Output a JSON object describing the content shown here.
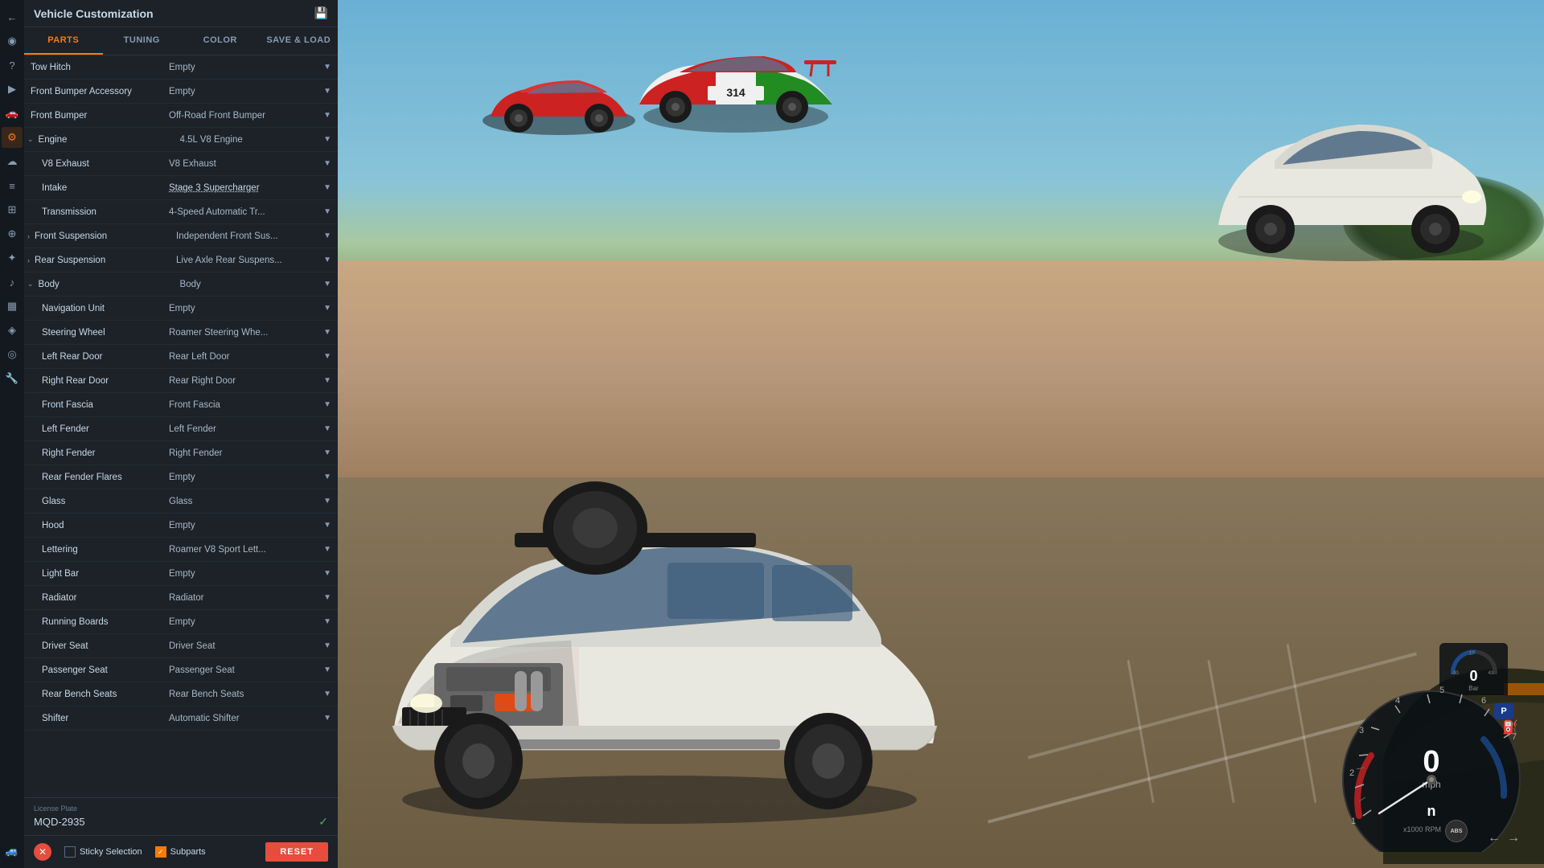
{
  "panel": {
    "title": "Vehicle Customization",
    "tabs": [
      {
        "id": "parts",
        "label": "PARTS",
        "active": true
      },
      {
        "id": "tuning",
        "label": "TUNING",
        "active": false
      },
      {
        "id": "color",
        "label": "COLOR",
        "active": false
      },
      {
        "id": "save_load",
        "label": "SAVE & LOAD",
        "active": false
      }
    ]
  },
  "parts": [
    {
      "name": "Tow Hitch",
      "value": "Empty",
      "indent": 0,
      "dropdown": true,
      "underline": false
    },
    {
      "name": "Front Bumper Accessory",
      "value": "Empty",
      "indent": 0,
      "dropdown": true,
      "underline": false
    },
    {
      "name": "Front Bumper",
      "value": "Off-Road Front Bumper",
      "indent": 0,
      "dropdown": true,
      "underline": false
    },
    {
      "name": "Engine",
      "value": "4.5L V8 Engine",
      "indent": 0,
      "dropdown": true,
      "underline": false,
      "expandable": true,
      "expanded": true
    },
    {
      "name": "V8 Exhaust",
      "value": "V8 Exhaust",
      "indent": 1,
      "dropdown": true,
      "underline": false
    },
    {
      "name": "Intake",
      "value": "Stage 3 Supercharger",
      "indent": 1,
      "dropdown": true,
      "underline": true
    },
    {
      "name": "Transmission",
      "value": "4-Speed Automatic Tr...",
      "indent": 1,
      "dropdown": true,
      "underline": false
    },
    {
      "name": "Front Suspension",
      "value": "Independent Front Sus...",
      "indent": 0,
      "dropdown": true,
      "underline": false,
      "expandable": true,
      "expanded": false,
      "expandDir": "right"
    },
    {
      "name": "Rear Suspension",
      "value": "Live Axle Rear Suspens...",
      "indent": 0,
      "dropdown": true,
      "underline": false,
      "expandable": true,
      "expanded": false,
      "expandDir": "right"
    },
    {
      "name": "Body",
      "value": "Body",
      "indent": 0,
      "dropdown": true,
      "underline": false,
      "expandable": true,
      "expanded": true
    },
    {
      "name": "Navigation Unit",
      "value": "Empty",
      "indent": 1,
      "dropdown": true,
      "underline": false
    },
    {
      "name": "Steering Wheel",
      "value": "Roamer Steering Whe...",
      "indent": 1,
      "dropdown": true,
      "underline": false
    },
    {
      "name": "Left Rear Door",
      "value": "Rear Left Door",
      "indent": 1,
      "dropdown": true,
      "underline": false
    },
    {
      "name": "Right Rear Door",
      "value": "Rear Right Door",
      "indent": 1,
      "dropdown": true,
      "underline": false
    },
    {
      "name": "Front Fascia",
      "value": "Front Fascia",
      "indent": 1,
      "dropdown": true,
      "underline": false
    },
    {
      "name": "Left Fender",
      "value": "Left Fender",
      "indent": 1,
      "dropdown": true,
      "underline": false
    },
    {
      "name": "Right Fender",
      "value": "Right Fender",
      "indent": 1,
      "dropdown": true,
      "underline": false
    },
    {
      "name": "Rear Fender Flares",
      "value": "Empty",
      "indent": 1,
      "dropdown": true,
      "underline": false
    },
    {
      "name": "Glass",
      "value": "Glass",
      "indent": 1,
      "dropdown": true,
      "underline": false
    },
    {
      "name": "Hood",
      "value": "Empty",
      "indent": 1,
      "dropdown": true,
      "underline": false
    },
    {
      "name": "Lettering",
      "value": "Roamer V8 Sport Lett...",
      "indent": 1,
      "dropdown": true,
      "underline": false
    },
    {
      "name": "Light Bar",
      "value": "Empty",
      "indent": 1,
      "dropdown": true,
      "underline": false
    },
    {
      "name": "Radiator",
      "value": "Radiator",
      "indent": 1,
      "dropdown": true,
      "underline": false
    },
    {
      "name": "Running Boards",
      "value": "Empty",
      "indent": 1,
      "dropdown": true,
      "underline": false
    },
    {
      "name": "Driver Seat",
      "value": "Driver Seat",
      "indent": 1,
      "dropdown": true,
      "underline": false
    },
    {
      "name": "Passenger Seat",
      "value": "Passenger Seat",
      "indent": 1,
      "dropdown": true,
      "underline": false
    },
    {
      "name": "Rear Bench Seats",
      "value": "Rear Bench Seats",
      "indent": 1,
      "dropdown": true,
      "underline": false
    },
    {
      "name": "Shifter",
      "value": "Automatic Shifter",
      "indent": 1,
      "dropdown": true,
      "underline": false
    }
  ],
  "license_plate": {
    "label": "License Plate",
    "value": "MQD-2935"
  },
  "bottom": {
    "sticky_selection": "Sticky Selection",
    "subparts": "Subparts",
    "reset": "RESET"
  },
  "hud": {
    "speed": "0",
    "speed_unit": "mph",
    "rpm": "n",
    "gear": "P",
    "boost": "0",
    "boost_unit": "Bar"
  },
  "icon_strip": [
    {
      "name": "back-icon",
      "symbol": "←"
    },
    {
      "name": "map-icon",
      "symbol": "◉"
    },
    {
      "name": "help-icon",
      "symbol": "?"
    },
    {
      "name": "play-icon",
      "symbol": "▶"
    },
    {
      "name": "car-icon",
      "symbol": "🚗"
    },
    {
      "name": "gear-icon",
      "symbol": "⚙"
    },
    {
      "name": "cloud-icon",
      "symbol": "☁"
    },
    {
      "name": "list-icon",
      "symbol": "☰"
    },
    {
      "name": "tune-icon",
      "symbol": "⊞"
    },
    {
      "name": "nodes-icon",
      "symbol": "⊕"
    },
    {
      "name": "settings-icon",
      "symbol": "✦"
    },
    {
      "name": "sound-icon",
      "symbol": "♪"
    },
    {
      "name": "chart-icon",
      "symbol": "▦"
    },
    {
      "name": "signal-icon",
      "symbol": "◈"
    },
    {
      "name": "camera-icon",
      "symbol": "◎"
    },
    {
      "name": "wrench-icon",
      "symbol": "🔧"
    },
    {
      "name": "vehicle-icon",
      "symbol": "🚙"
    }
  ]
}
